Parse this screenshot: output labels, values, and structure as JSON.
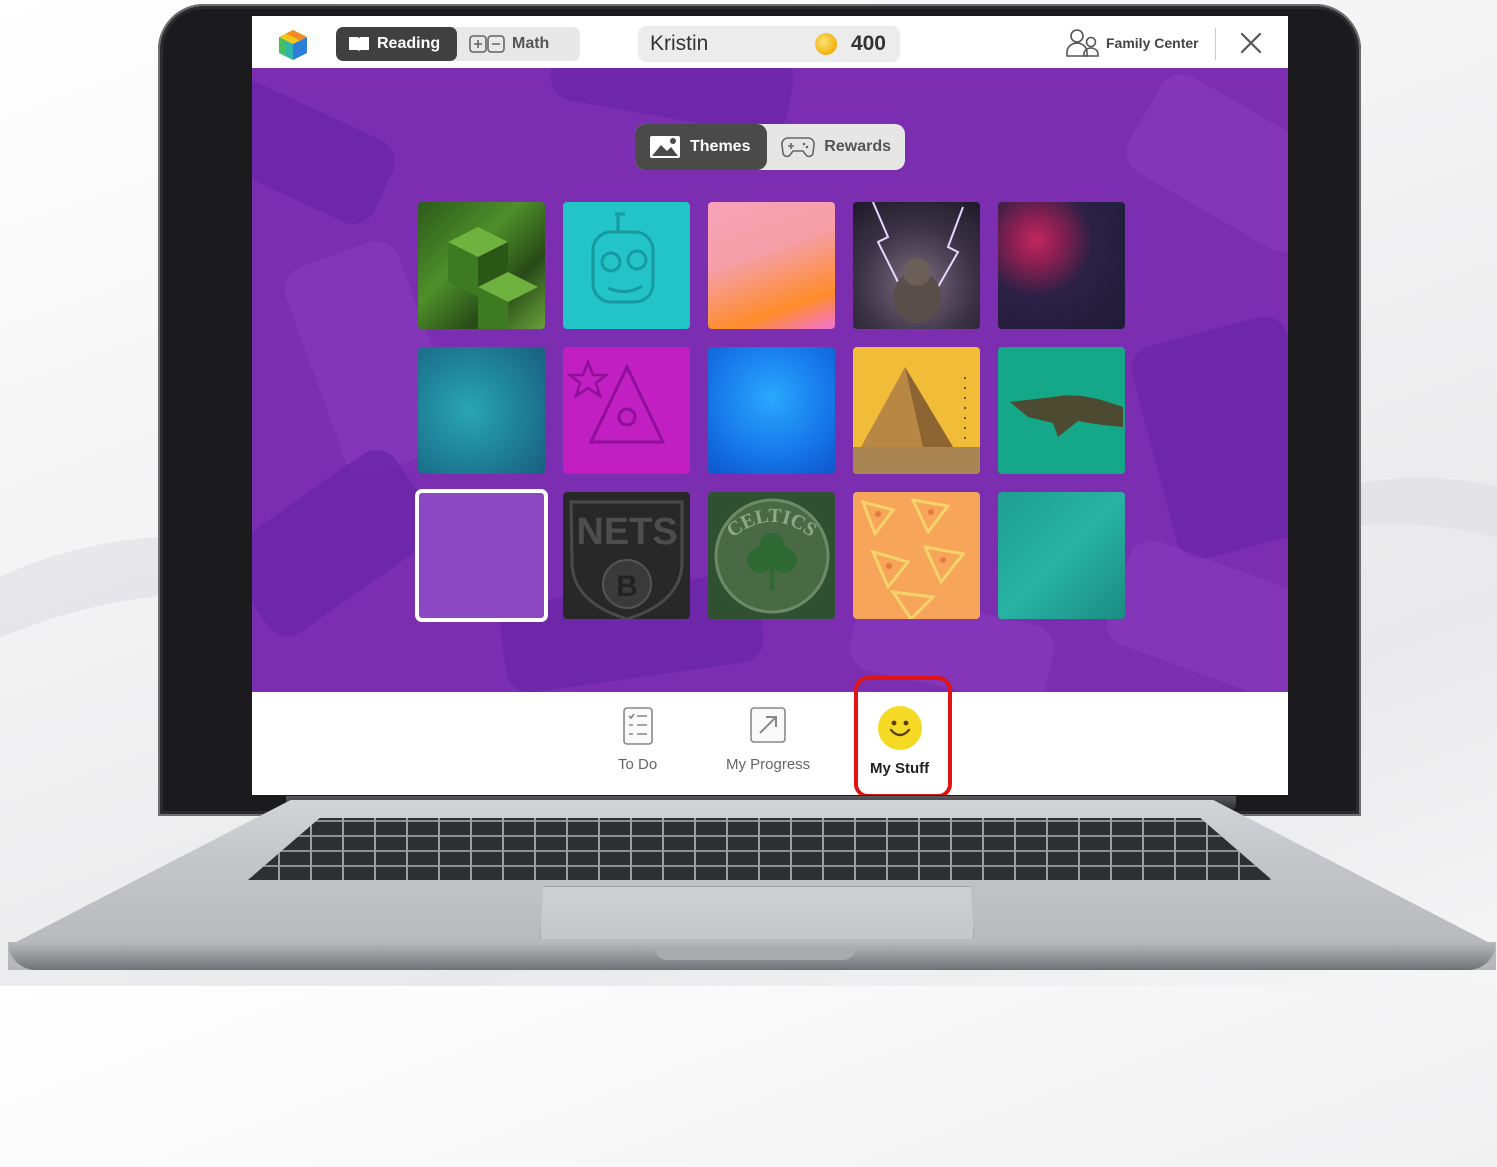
{
  "header": {
    "subject_tabs": [
      {
        "label": "Reading",
        "active": true
      },
      {
        "label": "Math",
        "active": false
      }
    ],
    "user_name": "Kristin",
    "coins": "400",
    "family_center": "Family Center"
  },
  "stage": {
    "tabs": [
      {
        "label": "Themes",
        "active": true
      },
      {
        "label": "Rewards",
        "active": false
      }
    ],
    "themes": [
      {
        "name": "green-cubes"
      },
      {
        "name": "teal-robot"
      },
      {
        "name": "pink-orange-gradient"
      },
      {
        "name": "lightning-cat"
      },
      {
        "name": "dark-splatter"
      },
      {
        "name": "teal-galaxy"
      },
      {
        "name": "magenta-doodles"
      },
      {
        "name": "blue-water"
      },
      {
        "name": "pyramid"
      },
      {
        "name": "alligator"
      },
      {
        "name": "purple-default",
        "selected": true
      },
      {
        "name": "nets-logo",
        "text": "NETS"
      },
      {
        "name": "celtics-logo",
        "text": "CELTICS"
      },
      {
        "name": "pizza-pattern"
      },
      {
        "name": "teal-leaves"
      }
    ]
  },
  "bottom_nav": {
    "items": [
      {
        "label": "To Do"
      },
      {
        "label": "My Progress"
      },
      {
        "label": "My Stuff",
        "active": true
      }
    ]
  },
  "colors": {
    "stage_purple": "#7b2fb0",
    "highlight_red": "#e11414",
    "coin_gold": "#f3b511"
  },
  "icons": [
    "app-logo-cube-icon",
    "book-icon",
    "plus-minus-icon",
    "coin-icon",
    "family-icon",
    "close-icon",
    "image-icon",
    "gamepad-icon",
    "checklist-icon",
    "arrow-progress-icon",
    "smiley-icon"
  ]
}
